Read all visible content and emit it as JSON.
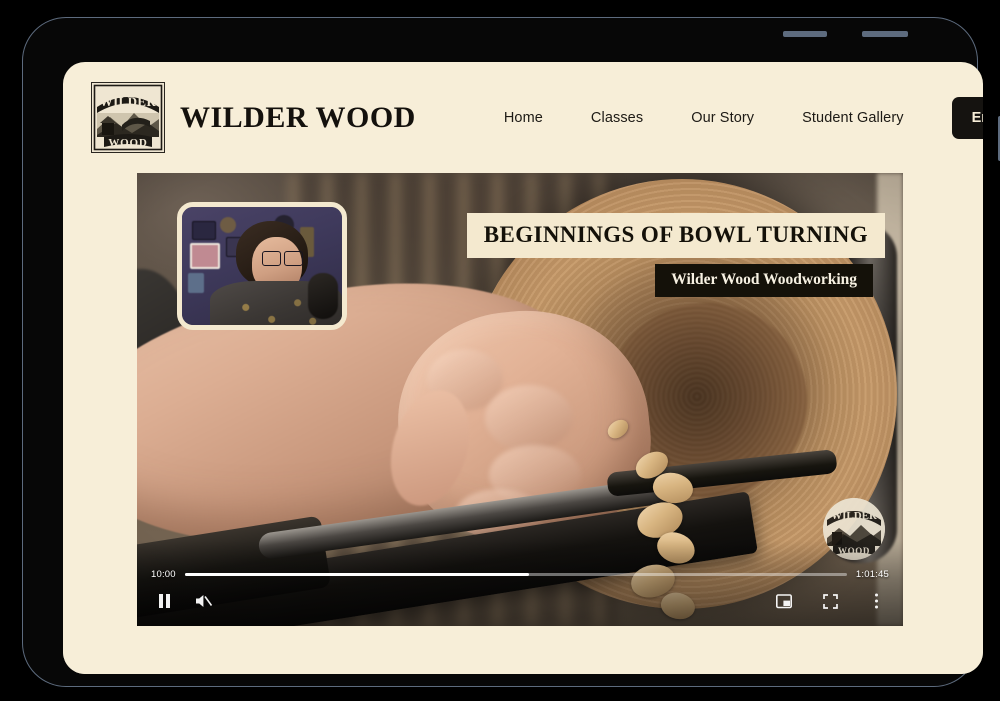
{
  "site": {
    "brand_name": "WILDER WOOD",
    "logo_icon": "wilder-wood-woodcut-badge",
    "logo_top_text": "WILDER",
    "logo_bottom_text": "WOOD"
  },
  "nav": {
    "items": [
      {
        "label": "Home"
      },
      {
        "label": "Classes"
      },
      {
        "label": "Our Story"
      },
      {
        "label": "Student Gallery"
      }
    ],
    "cta_label": "Enroll Now"
  },
  "video": {
    "title": "BEGINNINGS OF BOWL TURNING",
    "subtitle": "Wilder Wood Woodworking",
    "watermark_top_text": "WILDER",
    "watermark_bottom_text": "WOOD",
    "pip_label": "instructor-webcam-inset"
  },
  "player": {
    "current_time": "10:00",
    "duration": "1:01:45",
    "progress_percent": 52,
    "play_state_icon": "pause-icon",
    "volume_state_icon": "volume-muted-icon",
    "miniplayer_icon": "miniplayer-icon",
    "fullscreen_icon": "fullscreen-icon",
    "more_options_icon": "more-vertical-icon"
  },
  "device": {
    "type": "tablet",
    "volume_up_button": "volume-up-button",
    "volume_down_button": "volume-down-button",
    "power_button": "power-button"
  },
  "colors": {
    "page_cream": "#f7eed8",
    "title_cream": "#f4e9cf",
    "ink_black": "#141109",
    "device_bezel": "#070707",
    "device_edge": "#5d6b7e"
  }
}
